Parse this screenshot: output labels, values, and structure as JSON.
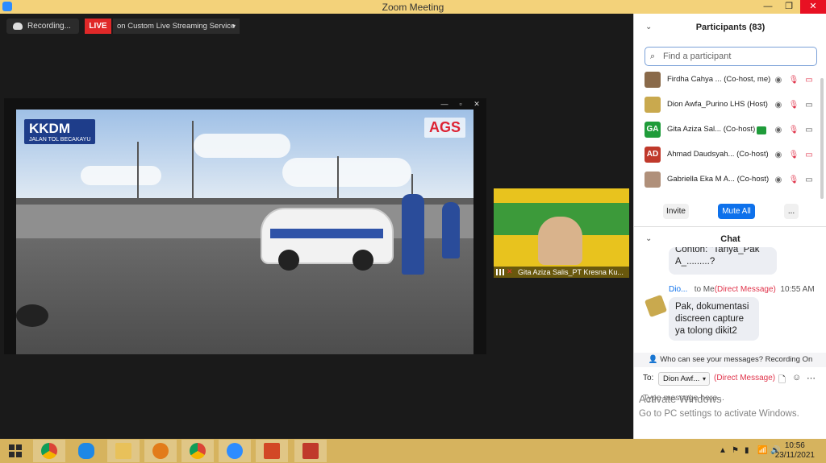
{
  "window": {
    "title": "Zoom Meeting",
    "controls": {
      "minimize": "—",
      "restore": "❐",
      "close": "✕"
    }
  },
  "recording": {
    "label": "Recording..."
  },
  "live": {
    "badge": "LIVE",
    "service": "on Custom Live Streaming Service",
    "caret": "▾"
  },
  "shared_video": {
    "logo_left": "KKDM",
    "logo_left_sub": "JALAN TOL BECAKAYU",
    "logo_right": "AGS",
    "controls": {
      "minimize": "—",
      "restore": "▫",
      "close": "✕"
    }
  },
  "thumbnail": {
    "name": "Gita Aziza Salis_PT Kresna Ku..."
  },
  "participants": {
    "header": "Participants (83)",
    "search_placeholder": "Find a participant",
    "list": [
      {
        "name": "Firdha Cahya ... (Co-host, me)",
        "initials": "",
        "avatar_color": "#8a6a4a",
        "video_off": true
      },
      {
        "name": "Dion Awfa_Purino LHS (Host)",
        "initials": "",
        "avatar_color": "#c9a94e",
        "video_off": false
      },
      {
        "name": "Gita Aziza Sal... (Co-host)",
        "initials": "GA",
        "avatar_color": "#1f9c3a",
        "video_off": false
      },
      {
        "name": "Ahmad Daudsyah... (Co-host)",
        "initials": "AD",
        "avatar_color": "#c0392b",
        "video_off": true
      },
      {
        "name": "Gabriella Eka M A... (Co-host)",
        "initials": "",
        "avatar_color": "#b0907a",
        "video_off": false
      }
    ],
    "invite": "Invite",
    "mute_all": "Mute All",
    "more": "..."
  },
  "chat": {
    "header": "Chat",
    "prev_message": "Contoh: \"Tanya_Pak A_.........?",
    "sender": "Dio...",
    "to": "to Me",
    "direct": "(Direct Message)",
    "time": "10:55 AM",
    "message": "Pak, dokumentasi discreen capture ya tolong dikit2",
    "privacy_note": "Who can see your messages? Recording On",
    "to_label": "To:",
    "recipient": "Dion Awf...",
    "recipient_caret": "▾",
    "input_placeholder": "Type message here..."
  },
  "watermark": {
    "line1": "Activate Windows",
    "line2": "Go to PC settings to activate Windows."
  },
  "taskbar": {
    "apps": [
      "chrome",
      "internet-explorer",
      "file-explorer",
      "media",
      "chrome",
      "zoom",
      "powerpoint",
      "app"
    ],
    "time": "10:56",
    "date": "23/11/2021"
  }
}
